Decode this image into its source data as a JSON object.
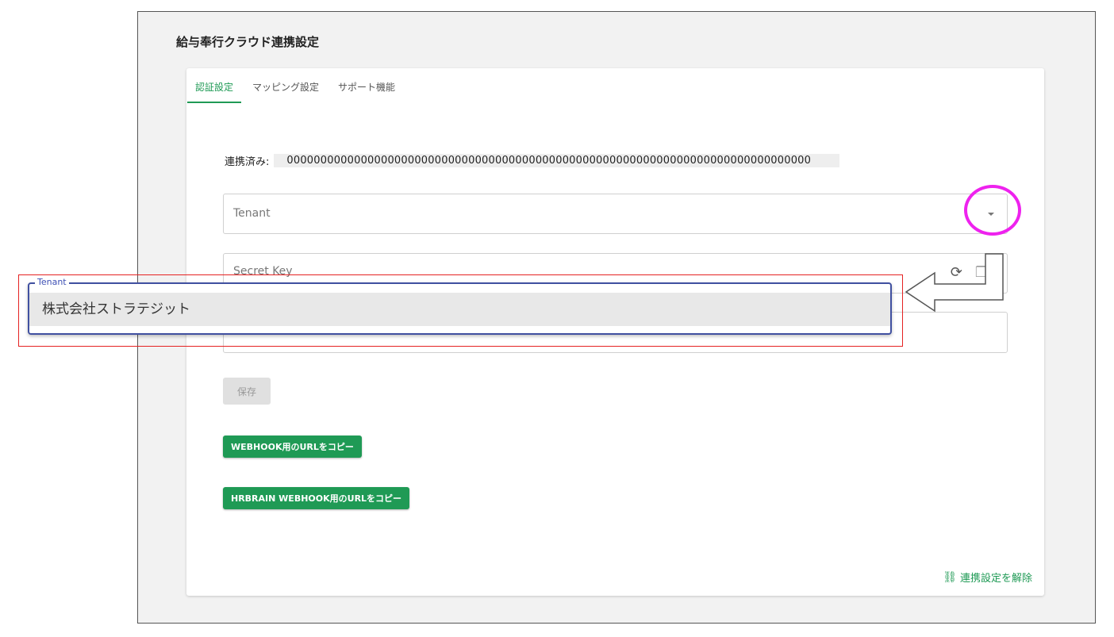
{
  "page": {
    "title": "給与奉行クラウド連携設定"
  },
  "tabs": [
    {
      "label": "認証設定",
      "active": true
    },
    {
      "label": "マッピング設定",
      "active": false
    },
    {
      "label": "サポート機能",
      "active": false
    }
  ],
  "linked": {
    "label": "連携済み:",
    "value": "000000000000000000000000000000000000000000000000000000000000000000000000000000"
  },
  "fields": {
    "tenant": {
      "placeholder": "Tenant",
      "icon": "chevron-down-icon"
    },
    "secret_key": {
      "placeholder": "Secret Key",
      "icons": [
        "refresh-icon",
        "copy-icon"
      ]
    }
  },
  "popup": {
    "legend": "Tenant",
    "options": [
      "株式会社ストラテジット"
    ]
  },
  "buttons": {
    "save": "保存",
    "webhook": "WEBHOOK用のURLをコピー",
    "hrbrain": "HRBRAIN WEBHOOK用のURLをコピー"
  },
  "unlink": {
    "label": "連携設定を解除",
    "icon": "link-off-icon"
  },
  "colors": {
    "accent": "#1f9a55",
    "highlight": "#ee22ee",
    "popup_border": "#4050a0",
    "annotation_box": "#e52222"
  }
}
